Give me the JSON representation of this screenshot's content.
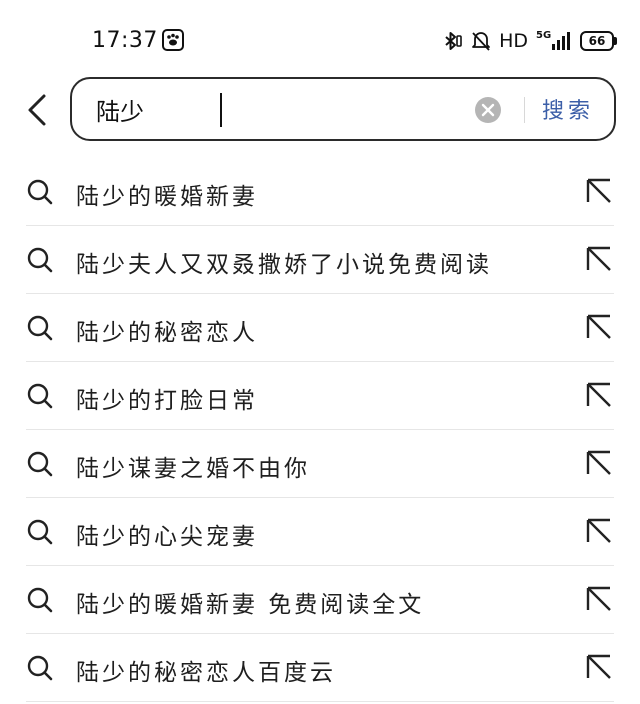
{
  "status_bar": {
    "time": "17:37",
    "network_label": "HD",
    "signal_label": "5G",
    "battery_level": "66"
  },
  "search": {
    "query": "陆少",
    "search_button_label": "搜索"
  },
  "suggestions": [
    {
      "text": "陆少的暖婚新妻"
    },
    {
      "text": "陆少夫人又双叒撒娇了小说免费阅读"
    },
    {
      "text": "陆少的秘密恋人"
    },
    {
      "text": "陆少的打脸日常"
    },
    {
      "text": "陆少谋妻之婚不由你"
    },
    {
      "text": "陆少的心尖宠妻"
    },
    {
      "text": "陆少的暖婚新妻 免费阅读全文"
    },
    {
      "text": "陆少的秘密恋人百度云"
    }
  ],
  "icons": {
    "back": "chevron-left-icon",
    "clear": "clear-circle-x-icon",
    "suggestion": "search-icon",
    "fill": "arrow-up-left-icon"
  },
  "colors": {
    "accent": "#3c5fa8",
    "text": "#1f1f1f",
    "divider": "#e6e6e6"
  }
}
